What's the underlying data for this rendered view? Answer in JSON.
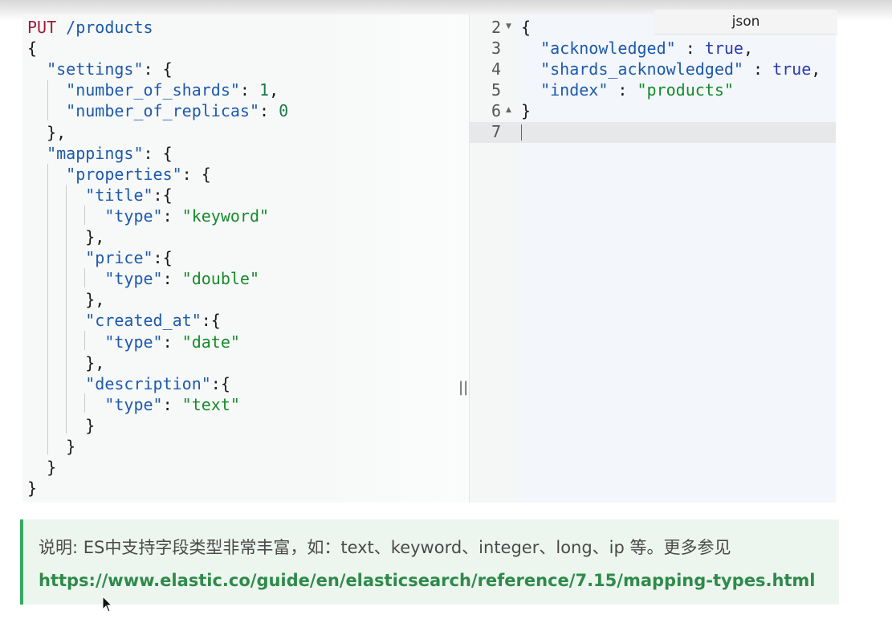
{
  "request_lines": [
    {
      "parts": [
        {
          "t": "PUT",
          "c": "method"
        },
        {
          "t": " /products",
          "c": "key"
        }
      ]
    },
    {
      "parts": [
        {
          "t": "{",
          "c": "punc"
        }
      ]
    },
    {
      "parts": [
        {
          "t": "  ",
          "c": "punc"
        },
        {
          "t": "\"settings\"",
          "c": "key"
        },
        {
          "t": ": {",
          "c": "punc"
        }
      ]
    },
    {
      "parts": [
        {
          "t": "    ",
          "c": "punc"
        },
        {
          "t": "\"number_of_shards\"",
          "c": "key"
        },
        {
          "t": ": ",
          "c": "punc"
        },
        {
          "t": "1",
          "c": "num"
        },
        {
          "t": ",",
          "c": "punc"
        }
      ]
    },
    {
      "parts": [
        {
          "t": "    ",
          "c": "punc"
        },
        {
          "t": "\"number_of_replicas\"",
          "c": "key"
        },
        {
          "t": ": ",
          "c": "punc"
        },
        {
          "t": "0",
          "c": "num"
        }
      ]
    },
    {
      "parts": [
        {
          "t": "  },",
          "c": "punc"
        }
      ]
    },
    {
      "parts": [
        {
          "t": "  ",
          "c": "punc"
        },
        {
          "t": "\"mappings\"",
          "c": "key"
        },
        {
          "t": ": {",
          "c": "punc"
        }
      ]
    },
    {
      "parts": [
        {
          "t": "    ",
          "c": "punc"
        },
        {
          "t": "\"properties\"",
          "c": "key"
        },
        {
          "t": ": {",
          "c": "punc"
        }
      ]
    },
    {
      "parts": [
        {
          "t": "      ",
          "c": "punc"
        },
        {
          "t": "\"title\"",
          "c": "key"
        },
        {
          "t": ":{",
          "c": "punc"
        }
      ]
    },
    {
      "parts": [
        {
          "t": "        ",
          "c": "punc"
        },
        {
          "t": "\"type\"",
          "c": "key"
        },
        {
          "t": ": ",
          "c": "punc"
        },
        {
          "t": "\"keyword\"",
          "c": "str"
        }
      ]
    },
    {
      "parts": [
        {
          "t": "      },",
          "c": "punc"
        }
      ]
    },
    {
      "parts": [
        {
          "t": "      ",
          "c": "punc"
        },
        {
          "t": "\"price\"",
          "c": "key"
        },
        {
          "t": ":{",
          "c": "punc"
        }
      ]
    },
    {
      "parts": [
        {
          "t": "        ",
          "c": "punc"
        },
        {
          "t": "\"type\"",
          "c": "key"
        },
        {
          "t": ": ",
          "c": "punc"
        },
        {
          "t": "\"double\"",
          "c": "str"
        }
      ]
    },
    {
      "parts": [
        {
          "t": "      },",
          "c": "punc"
        }
      ]
    },
    {
      "parts": [
        {
          "t": "      ",
          "c": "punc"
        },
        {
          "t": "\"created_at\"",
          "c": "key"
        },
        {
          "t": ":{",
          "c": "punc"
        }
      ]
    },
    {
      "parts": [
        {
          "t": "        ",
          "c": "punc"
        },
        {
          "t": "\"type\"",
          "c": "key"
        },
        {
          "t": ": ",
          "c": "punc"
        },
        {
          "t": "\"date\"",
          "c": "str"
        }
      ]
    },
    {
      "parts": [
        {
          "t": "      },",
          "c": "punc"
        }
      ]
    },
    {
      "parts": [
        {
          "t": "      ",
          "c": "punc"
        },
        {
          "t": "\"description\"",
          "c": "key"
        },
        {
          "t": ":{",
          "c": "punc"
        }
      ]
    },
    {
      "parts": [
        {
          "t": "        ",
          "c": "punc"
        },
        {
          "t": "\"type\"",
          "c": "key"
        },
        {
          "t": ": ",
          "c": "punc"
        },
        {
          "t": "\"text\"",
          "c": "str"
        }
      ]
    },
    {
      "parts": [
        {
          "t": "      }",
          "c": "punc"
        }
      ]
    },
    {
      "parts": [
        {
          "t": "    }",
          "c": "punc"
        }
      ]
    },
    {
      "parts": [
        {
          "t": "  }",
          "c": "punc"
        }
      ]
    },
    {
      "parts": [
        {
          "t": "}",
          "c": "punc"
        }
      ]
    }
  ],
  "response": {
    "tab_label": "json",
    "line_numbers": [
      "2",
      "3",
      "4",
      "5",
      "6",
      "7"
    ],
    "lines": [
      {
        "parts": [
          {
            "t": "{",
            "c": "punc"
          }
        ]
      },
      {
        "parts": [
          {
            "t": "  ",
            "c": "punc"
          },
          {
            "t": "\"acknowledged\"",
            "c": "key"
          },
          {
            "t": " : ",
            "c": "punc"
          },
          {
            "t": "true",
            "c": "bool"
          },
          {
            "t": ",",
            "c": "punc"
          }
        ]
      },
      {
        "parts": [
          {
            "t": "  ",
            "c": "punc"
          },
          {
            "t": "\"shards_acknowledged\"",
            "c": "key"
          },
          {
            "t": " : ",
            "c": "punc"
          },
          {
            "t": "true",
            "c": "bool"
          },
          {
            "t": ",",
            "c": "punc"
          }
        ]
      },
      {
        "parts": [
          {
            "t": "  ",
            "c": "punc"
          },
          {
            "t": "\"index\"",
            "c": "key"
          },
          {
            "t": " : ",
            "c": "punc"
          },
          {
            "t": "\"products\"",
            "c": "str"
          }
        ]
      },
      {
        "parts": [
          {
            "t": "}",
            "c": "punc"
          }
        ]
      },
      {
        "parts": []
      }
    ]
  },
  "splitter_glyph": "||",
  "note": {
    "prefix": "说明: ES中支持字段类型非常丰富，如：text、keyword、integer、long、ip 等。更多参见 ",
    "link": "https://www.elastic.co/guide/en/elasticsearch/reference/7.15/mapping-types.html"
  },
  "colors": {
    "method": "#a01a3c",
    "key": "#1d59ad",
    "string": "#178a2c",
    "number": "#1a7a4c",
    "bool": "#2a3cb0",
    "note_accent": "#3aa860"
  }
}
